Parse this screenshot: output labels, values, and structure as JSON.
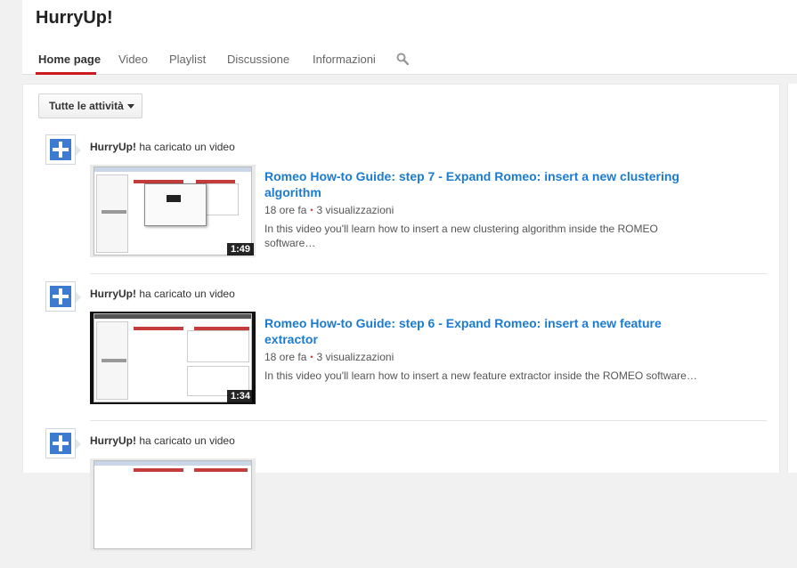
{
  "channel": {
    "name": "HurryUp!"
  },
  "tabs": [
    {
      "label": "Home page",
      "active": true
    },
    {
      "label": "Video"
    },
    {
      "label": "Playlist"
    },
    {
      "label": "Discussione"
    },
    {
      "label": "Informazioni"
    }
  ],
  "search_icon": "search-icon",
  "filter": {
    "label": "Tutte le attività"
  },
  "feed": [
    {
      "uploader": "HurryUp!",
      "action": " ha caricato un video",
      "title": "Romeo How-to Guide: step 7 - Expand Romeo: insert a new clustering algorithm",
      "age": "18 ore fa",
      "views": "3 visualizzazioni",
      "description": "In this video you'll learn how to insert a new clustering algorithm inside the ROMEO software…",
      "duration": "1:49"
    },
    {
      "uploader": "HurryUp!",
      "action": " ha caricato un video",
      "title": "Romeo How-to Guide: step 6 - Expand Romeo: insert a new feature extractor",
      "age": "18 ore fa",
      "views": "3 visualizzazioni",
      "description": "In this video you'll learn how to insert a new feature extractor inside the ROMEO software…",
      "duration": "1:34"
    },
    {
      "uploader": "HurryUp!",
      "action": " ha caricato un video",
      "title": "",
      "age": "",
      "views": "",
      "description": "",
      "duration": ""
    }
  ],
  "colors": {
    "accent": "#cc181e",
    "link": "#1b7bd1",
    "avatar": "#3d7bd1"
  }
}
